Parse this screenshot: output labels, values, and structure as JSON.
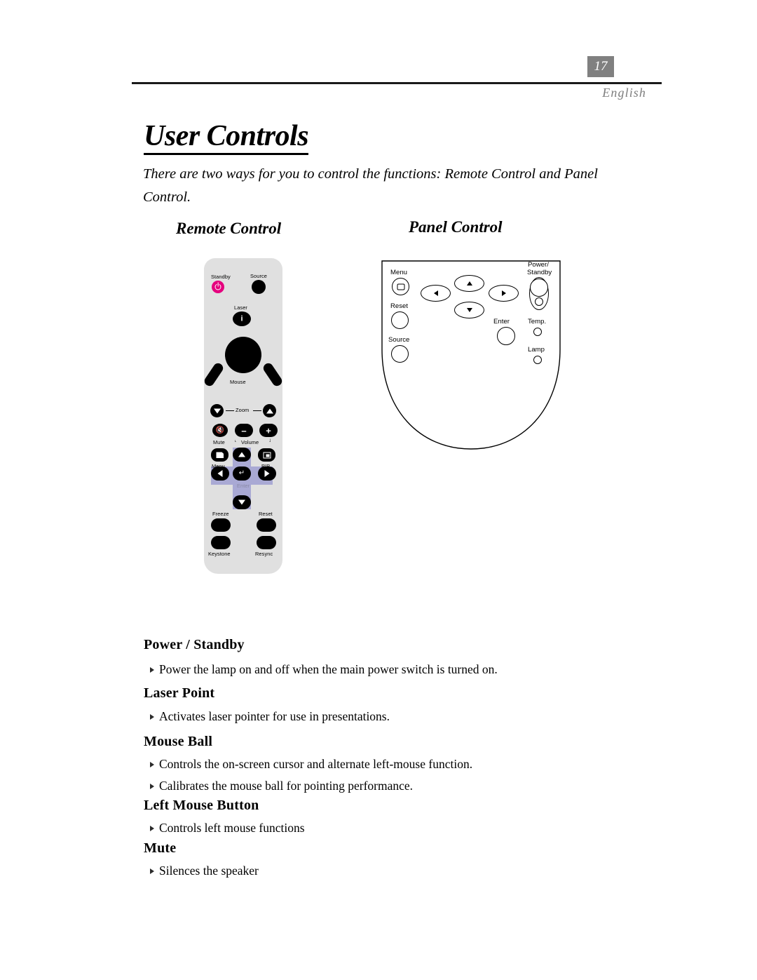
{
  "header": {
    "page_number": "17",
    "language": "English"
  },
  "title": "User Controls",
  "intro": "There are two ways for you to control the functions: Remote Control and Panel Control.",
  "diagrams": {
    "remote": {
      "heading": "Remote Control",
      "labels": {
        "standby": "Standby",
        "source": "Source",
        "laser": "Laser",
        "laser_glyph": "i",
        "mouse": "Mouse",
        "zoom": "Zoom",
        "mute": "Mute",
        "volume": "Volume",
        "volume_bracket_left": "˪",
        "volume_bracket_right": "˩",
        "menu": "Menu",
        "pip": "PIP",
        "enter": "Enter",
        "freeze": "Freeze",
        "reset": "Reset",
        "keystone": "Keystone",
        "resync": "Resync",
        "mute_glyph": " ",
        "enter_glyph": "↵",
        "volume_minus": "–",
        "volume_plus": "+"
      },
      "colors": {
        "body": "#e0e0e0",
        "button": "#000000",
        "standby": "#e5007e",
        "nav_cross": "#a9a9d4",
        "enter_text": "#8a8aa8"
      }
    },
    "panel": {
      "heading": "Panel Control",
      "labels": {
        "menu": "Menu",
        "reset": "Reset",
        "source": "Source",
        "enter": "Enter",
        "power_standby_line1": "Power/",
        "power_standby_line2": "Standby",
        "temp": "Temp.",
        "lamp": "Lamp"
      }
    }
  },
  "sections": [
    {
      "heading": "Power / Standby",
      "items": [
        "Power the lamp on and off when the main power switch is turned on."
      ]
    },
    {
      "heading": "Laser Point",
      "items": [
        "Activates laser pointer for use in presentations."
      ]
    },
    {
      "heading": "Mouse Ball",
      "items": [
        "Controls the on-screen cursor and alternate left-mouse function.",
        "Calibrates the mouse ball for pointing performance."
      ]
    },
    {
      "heading": "Left Mouse Button",
      "items": [
        "Controls left mouse functions"
      ]
    },
    {
      "heading": "Mute",
      "items": [
        "Silences the speaker"
      ]
    }
  ]
}
